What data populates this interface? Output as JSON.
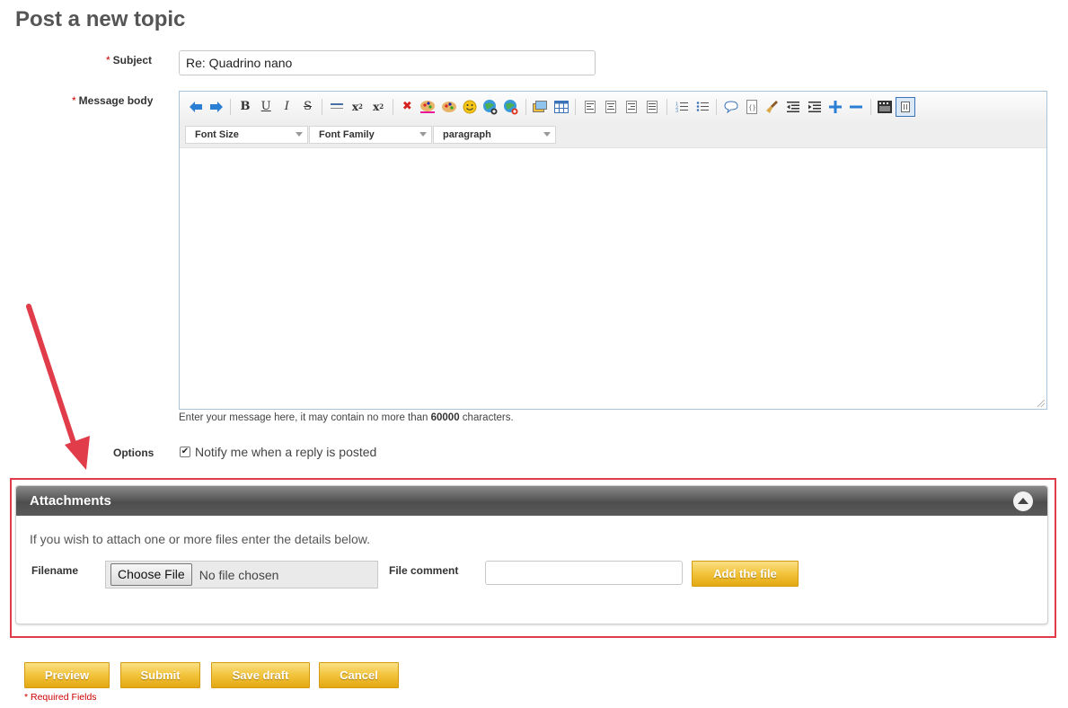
{
  "page": {
    "title": "Post a new topic"
  },
  "form": {
    "required_marker": "*",
    "subject_label": "Subject",
    "subject_value": "Re: Quadrino nano",
    "message_label": "Message body",
    "hint_prefix": "Enter your message here, it may contain no more than ",
    "hint_limit": "60000",
    "hint_suffix": " characters.",
    "options_label": "Options",
    "notify_checked": true,
    "notify_label": "Notify me when a reply is posted"
  },
  "editor": {
    "toolbar_icons": [
      "undo-icon",
      "redo-icon",
      "bold-icon",
      "underline-icon",
      "italic-icon",
      "strikethrough-icon",
      "horizontal-rule-icon",
      "superscript-icon",
      "subscript-icon",
      "remove-format-icon",
      "text-color-icon",
      "background-color-icon",
      "emoticon-icon",
      "insert-link-icon",
      "unlink-icon",
      "insert-image-icon",
      "insert-table-icon",
      "align-left-icon",
      "align-center-icon",
      "align-right-icon",
      "justify-icon",
      "ordered-list-icon",
      "unordered-list-icon",
      "quote-icon",
      "code-icon",
      "cleanup-icon",
      "outdent-icon",
      "indent-icon",
      "zoom-in-icon",
      "zoom-out-icon",
      "media-icon",
      "html-source-icon"
    ],
    "font_size_label": "Font Size",
    "font_family_label": "Font Family",
    "format_label": "paragraph"
  },
  "attachments": {
    "title": "Attachments",
    "info": "If you wish to attach one or more files enter the details below.",
    "filename_label": "Filename",
    "choose_file_label": "Choose File",
    "no_file_text": "No file chosen",
    "file_comment_label": "File comment",
    "add_file_label": "Add the file"
  },
  "actions": {
    "preview": "Preview",
    "submit": "Submit",
    "save_draft": "Save draft",
    "cancel": "Cancel",
    "required_fields": "* Required Fields"
  },
  "colors": {
    "annotation_red": "#e03c4a",
    "button_gold": "#f2c33b",
    "header_dark": "#4e4e4e"
  }
}
